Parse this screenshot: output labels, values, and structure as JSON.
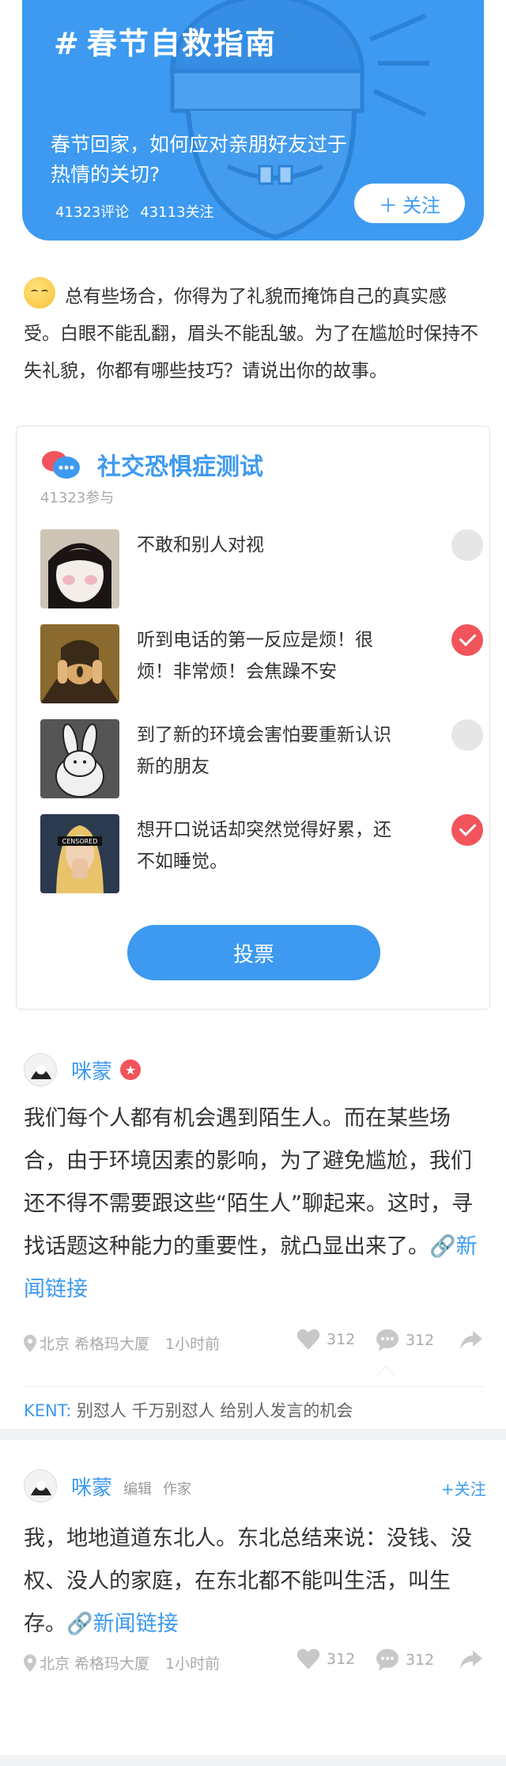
{
  "topic": {
    "hash": "#",
    "title": "春节自救指南",
    "desc": "春节回家，如何应对亲朋好友过于热情的关切?",
    "comments": "41323评论",
    "follows": "43113关注",
    "follow_label": "关注",
    "accent": "#3d9af0"
  },
  "intro": {
    "text": "总有些场合，你得为了礼貌而掩饰自己的真实感受。白眼不能乱翻，眉头不能乱皱。为了在尴尬时保持不失礼貌，你都有哪些技巧？请说出你的故事。"
  },
  "poll": {
    "title": "社交恐惧症测试",
    "participants": "41323参与",
    "options": [
      {
        "text": "不敢和别人对视",
        "checked": false
      },
      {
        "text": "听到电话的第一反应是烦！很烦！非常烦！会焦躁不安",
        "checked": true
      },
      {
        "text": "到了新的环境会害怕要重新认识新的朋友",
        "checked": false
      },
      {
        "text": "想开口说话却突然觉得好累，还不如睡觉。",
        "checked": true
      }
    ],
    "censored_label": "CENSORED",
    "vote_label": "投票"
  },
  "posts": [
    {
      "user": "咪蒙",
      "body": "我们每个人都有机会遇到陌生人。而在某些场合，由于环境因素的影响，为了避免尴尬，我们还不得不需要跟这些“陌生人”聊起来。这时，寻找话题这种能力的重要性，就凸显出来了。",
      "link": "新闻链接",
      "location": "北京 希格玛大厦",
      "time": "1小时前",
      "likes": "312",
      "comments": "312",
      "reply_user": "KENT:",
      "reply_text": " 别怼人 千万别怼人 给别人发言的机会"
    },
    {
      "user": "咪蒙",
      "role1": "编辑",
      "role2": "作家",
      "follow": "+关注",
      "body": "我，地地道道东北人。东北总结来说：没钱、没权、没人的家庭，在东北都不能叫生活，叫生存。",
      "link": "新闻链接",
      "location": "北京 希格玛大厦",
      "time": "1小时前",
      "likes": "312",
      "comments": "312"
    }
  ]
}
